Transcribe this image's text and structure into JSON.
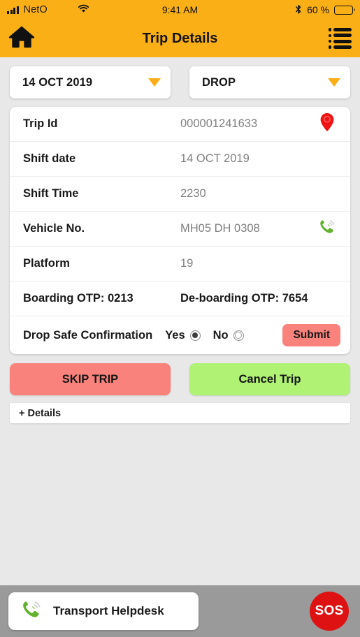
{
  "status_bar": {
    "carrier": "NetO",
    "signal_icon": "signal-bars-icon",
    "wifi_icon": "wifi-icon",
    "time": "9:41 AM",
    "bluetooth_icon": "bluetooth-icon",
    "battery_percent": "60 %",
    "battery_level": 60
  },
  "app_bar": {
    "home_icon": "home-icon",
    "title": "Trip Details",
    "menu_icon": "list-menu-icon"
  },
  "filters": {
    "date": {
      "value": "14 OCT 2019",
      "caret_icon": "caret-down-icon"
    },
    "trip_type": {
      "value": "DROP",
      "caret_icon": "caret-down-icon"
    }
  },
  "details": {
    "rows": [
      {
        "label": "Trip Id",
        "value": "000001241633",
        "icon": "location-pin-icon"
      },
      {
        "label": "Shift date",
        "value": "14 OCT 2019",
        "icon": ""
      },
      {
        "label": "Shift Time",
        "value": "2230",
        "icon": ""
      },
      {
        "label": "Vehicle No.",
        "value": "MH05 DH 0308",
        "icon": "phone-call-icon"
      },
      {
        "label": "Platform",
        "value": "19",
        "icon": ""
      }
    ],
    "otp": {
      "boarding": "Boarding OTP: 0213",
      "deboarding": "De-boarding OTP: 7654"
    },
    "confirmation": {
      "label": "Drop Safe Confirmation",
      "yes_label": "Yes",
      "no_label": "No",
      "selected": "Yes",
      "submit_label": "Submit"
    }
  },
  "actions": {
    "skip_label": "SKIP TRIP",
    "cancel_label": "Cancel Trip",
    "more_details_label": "+ Details"
  },
  "footer": {
    "helpdesk_label": "Transport Helpdesk",
    "helpdesk_icon": "phone-call-icon",
    "sos_label": "SOS"
  },
  "colors": {
    "brand_orange": "#FBAF17",
    "danger_red": "#DE1212",
    "salmon": "#F9837C",
    "lime": "#B0F274",
    "footer_gray": "#9A9A9A",
    "page_bg": "#E8E8E8"
  }
}
